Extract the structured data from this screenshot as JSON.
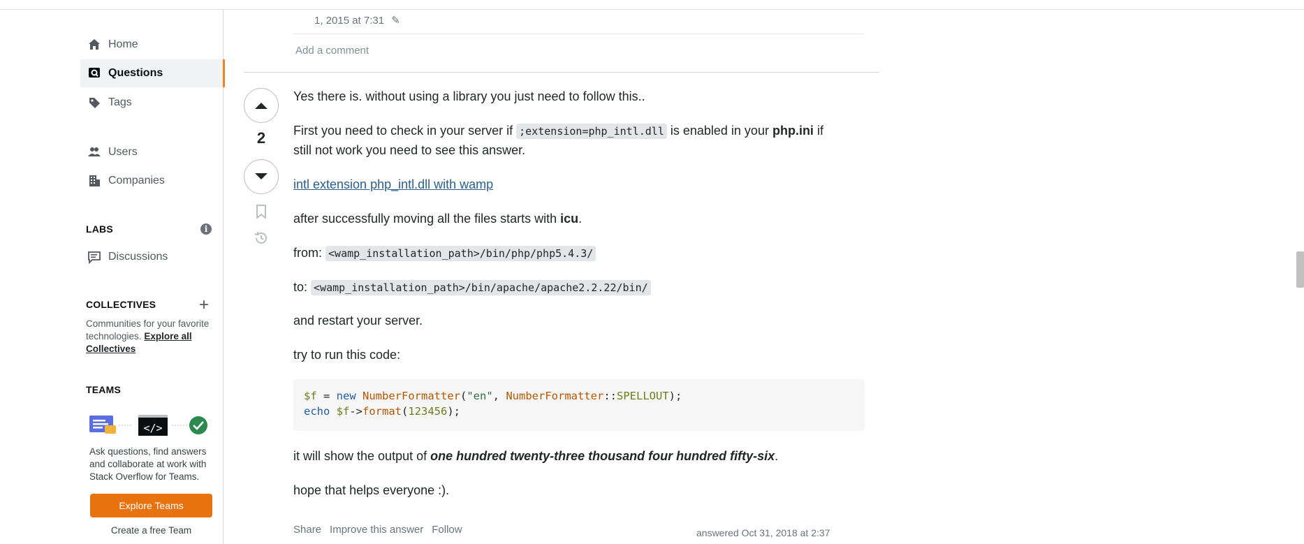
{
  "sidebar": {
    "nav": [
      {
        "label": "Home",
        "icon": "home-icon"
      },
      {
        "label": "Questions",
        "icon": "questions-icon",
        "active": true
      },
      {
        "label": "Tags",
        "icon": "tag-icon"
      },
      {
        "label": "Users",
        "icon": "users-icon"
      },
      {
        "label": "Companies",
        "icon": "companies-icon"
      }
    ],
    "labs_title": "LABS",
    "discussions_label": "Discussions",
    "collectives_title": "COLLECTIVES",
    "collectives_text": "Communities for your favorite technologies.",
    "collectives_link": "Explore all Collectives",
    "teams_title": "TEAMS",
    "teams_text": "Ask questions, find answers and collaborate at work with Stack Overflow for Teams.",
    "explore_teams": "Explore Teams",
    "free_team": "Create a free Team"
  },
  "comment": {
    "date": "1, 2015 at 7:31",
    "add_comment": "Add a comment"
  },
  "answer": {
    "votes": "2",
    "p1": "Yes there is. without using a library you just need to follow this..",
    "p2_a": "First you need to check in your server if ",
    "p2_code": ";extension=php_intl.dll",
    "p2_b": " is enabled in your ",
    "p2_bold": "php.ini",
    "p2_c": " if",
    "p2_line2": "still not work you need to see this answer.",
    "link": "intl extension php_intl.dll with wamp",
    "p4_a": "after successfully moving all the files starts with ",
    "p4_bold": "icu",
    "p4_b": ".",
    "from_label": "from: ",
    "from_code": "<wamp_installation_path>/bin/php/php5.4.3/",
    "to_label": "to: ",
    "to_code": "<wamp_installation_path>/bin/apache/apache2.2.22/bin/",
    "restart": "and restart your server.",
    "try": "try to run this code:",
    "output_a": "it will show the output of ",
    "output_em": "one hundred twenty-three thousand four hundred fifty-six",
    "output_b": ".",
    "hope": "hope that helps everyone :).",
    "share": "Share",
    "improve": "Improve this answer",
    "follow": "Follow",
    "answered": "answered Oct 31, 2018 at 2:37"
  },
  "code": {
    "l1_var": "$f",
    "l1_eq": " = ",
    "l1_new": "new",
    "l1_cls": "NumberFormatter",
    "l1_p1": "(",
    "l1_str": "\"en\"",
    "l1_comma": ", ",
    "l1_cls2": "NumberFormatter",
    "l1_dc": "::",
    "l1_const": "SPELLOUT",
    "l1_end": ");",
    "l2_echo": "echo",
    "l2_var": " $f",
    "l2_arrow": "->",
    "l2_fn": "format",
    "l2_p": "(",
    "l2_num": "123456",
    "l2_end": ");"
  }
}
